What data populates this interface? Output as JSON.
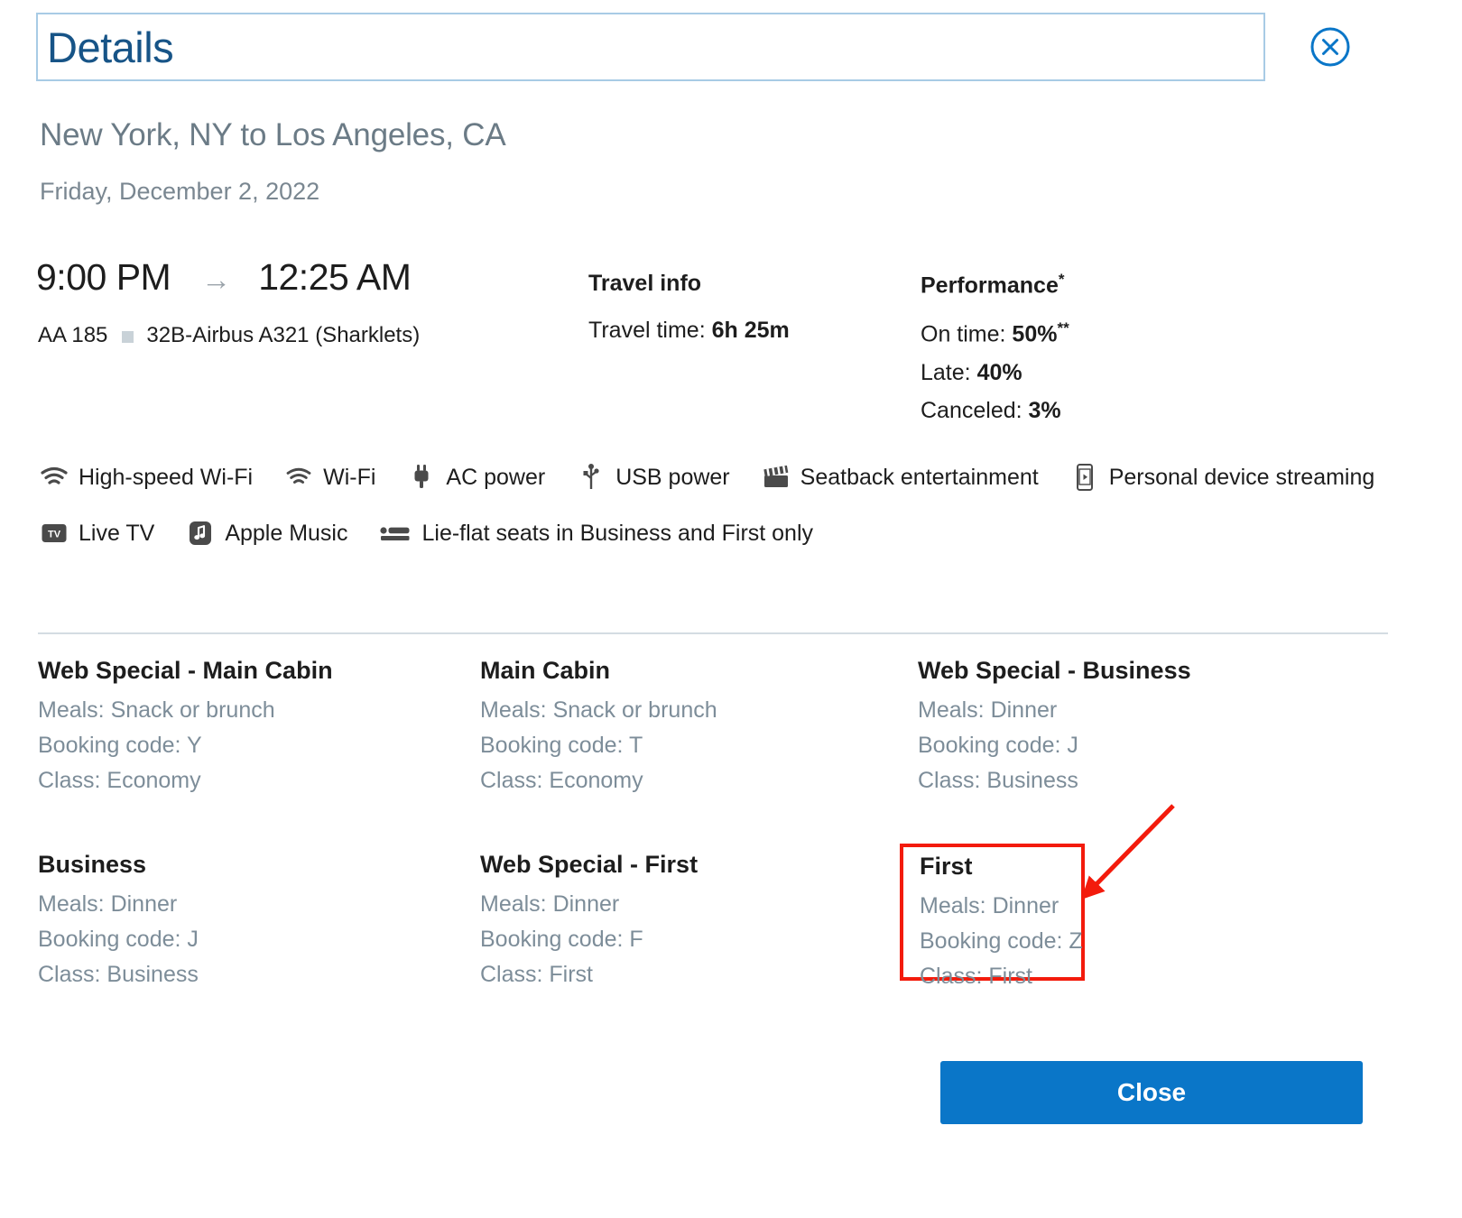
{
  "header": {
    "title": "Details",
    "close_icon": "close-circle-icon"
  },
  "flight": {
    "route": "New York, NY to Los Angeles, CA",
    "date": "Friday, December 2, 2022",
    "depart_time": "9:00 PM",
    "arrow": "→",
    "arrive_time": "12:25 AM",
    "flight_number": "AA 185",
    "aircraft": "32B-Airbus A321 (Sharklets)"
  },
  "travel_info": {
    "heading": "Travel info",
    "travel_time_label": "Travel time: ",
    "travel_time_value": "6h 25m"
  },
  "performance": {
    "heading": "Performance",
    "heading_sup": "*",
    "on_time_label": "On time: ",
    "on_time_value": "50%",
    "on_time_sup": "**",
    "late_label": "Late: ",
    "late_value": "40%",
    "canceled_label": "Canceled: ",
    "canceled_value": "3%"
  },
  "amenities": {
    "row1": [
      {
        "icon": "wifi-icon",
        "label": "High-speed Wi-Fi"
      },
      {
        "icon": "wifi-icon",
        "label": "Wi-Fi"
      },
      {
        "icon": "ac-power-plug-icon",
        "label": "AC power"
      },
      {
        "icon": "usb-power-icon",
        "label": "USB power"
      },
      {
        "icon": "clapperboard-icon",
        "label": "Seatback entertainment"
      },
      {
        "icon": "phone-streaming-icon",
        "label": "Personal device streaming"
      }
    ],
    "row2": [
      {
        "icon": "live-tv-icon",
        "label": "Live TV"
      },
      {
        "icon": "apple-music-icon",
        "label": "Apple Music"
      },
      {
        "icon": "lie-flat-seat-icon",
        "label": "Lie-flat seats in Business and First only"
      }
    ]
  },
  "fares": {
    "labels": {
      "meals": "Meals: ",
      "booking_code": "Booking code: ",
      "class": "Class: "
    },
    "row1": [
      {
        "title": "Web Special - Main Cabin",
        "meals": "Meals: Snack or brunch",
        "booking": "Booking code: Y",
        "cabin": "Class: Economy"
      },
      {
        "title": "Main Cabin",
        "meals": "Meals: Snack or brunch",
        "booking": "Booking code: T",
        "cabin": "Class: Economy"
      },
      {
        "title": "Web Special - Business",
        "meals": "Meals: Dinner",
        "booking": "Booking code: J",
        "cabin": "Class: Business"
      }
    ],
    "row2": [
      {
        "title": "Business",
        "meals": "Meals: Dinner",
        "booking": "Booking code: J",
        "cabin": "Class: Business"
      },
      {
        "title": "Web Special - First",
        "meals": "Meals: Dinner",
        "booking": "Booking code: F",
        "cabin": "Class: First"
      },
      {
        "title": "First",
        "meals": "Meals: Dinner",
        "booking": "Booking code: Z",
        "cabin": "Class: First",
        "highlighted": true
      }
    ]
  },
  "footer": {
    "close_label": "Close"
  },
  "colors": {
    "accent_blue": "#0a76c8",
    "title_blue": "#175487",
    "title_border": "#a8cbe5",
    "muted_text": "#7d8d99",
    "route_text": "#6b7b86",
    "divider": "#d4dce2",
    "annotation_red": "#f31b0c"
  }
}
